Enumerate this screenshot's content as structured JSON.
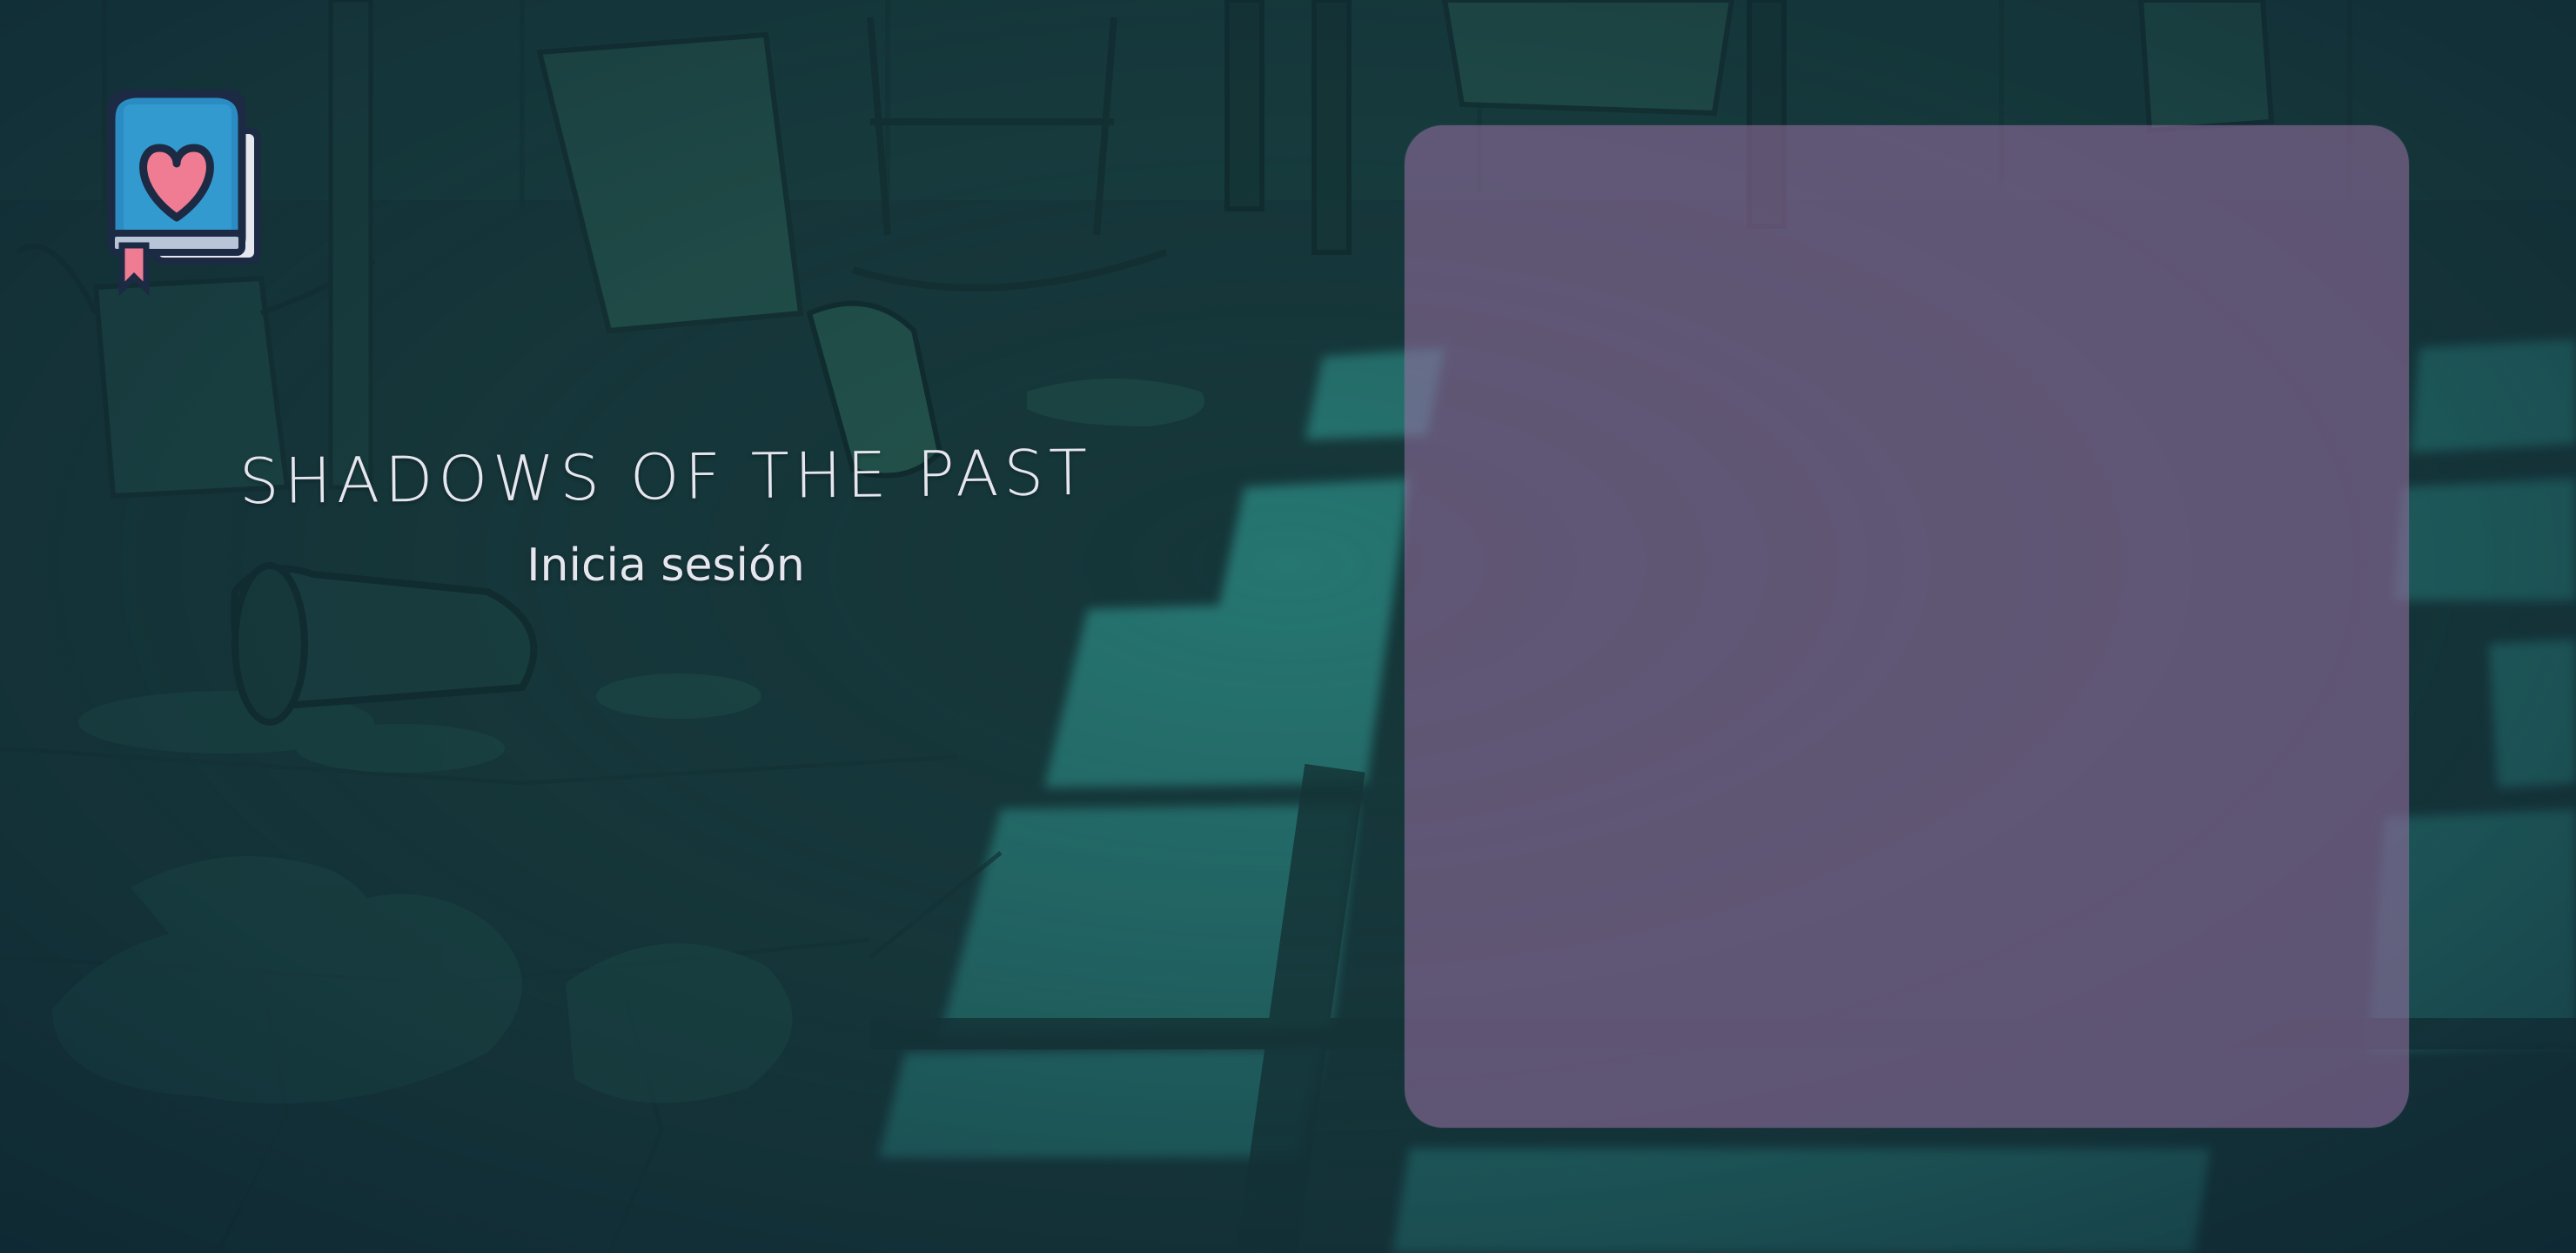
{
  "game": {
    "title": "SHADOWS OF THE PAST",
    "subtitle": "Inicia sesión"
  },
  "icons": {
    "logo": "book-with-heart-icon"
  },
  "colors": {
    "background": "#18393f",
    "window_light": "#2f8f86",
    "panel": "#966ea0",
    "text": "#e6e6ef",
    "logo_blue": "#2b8cc4",
    "logo_heart": "#f07c94"
  }
}
